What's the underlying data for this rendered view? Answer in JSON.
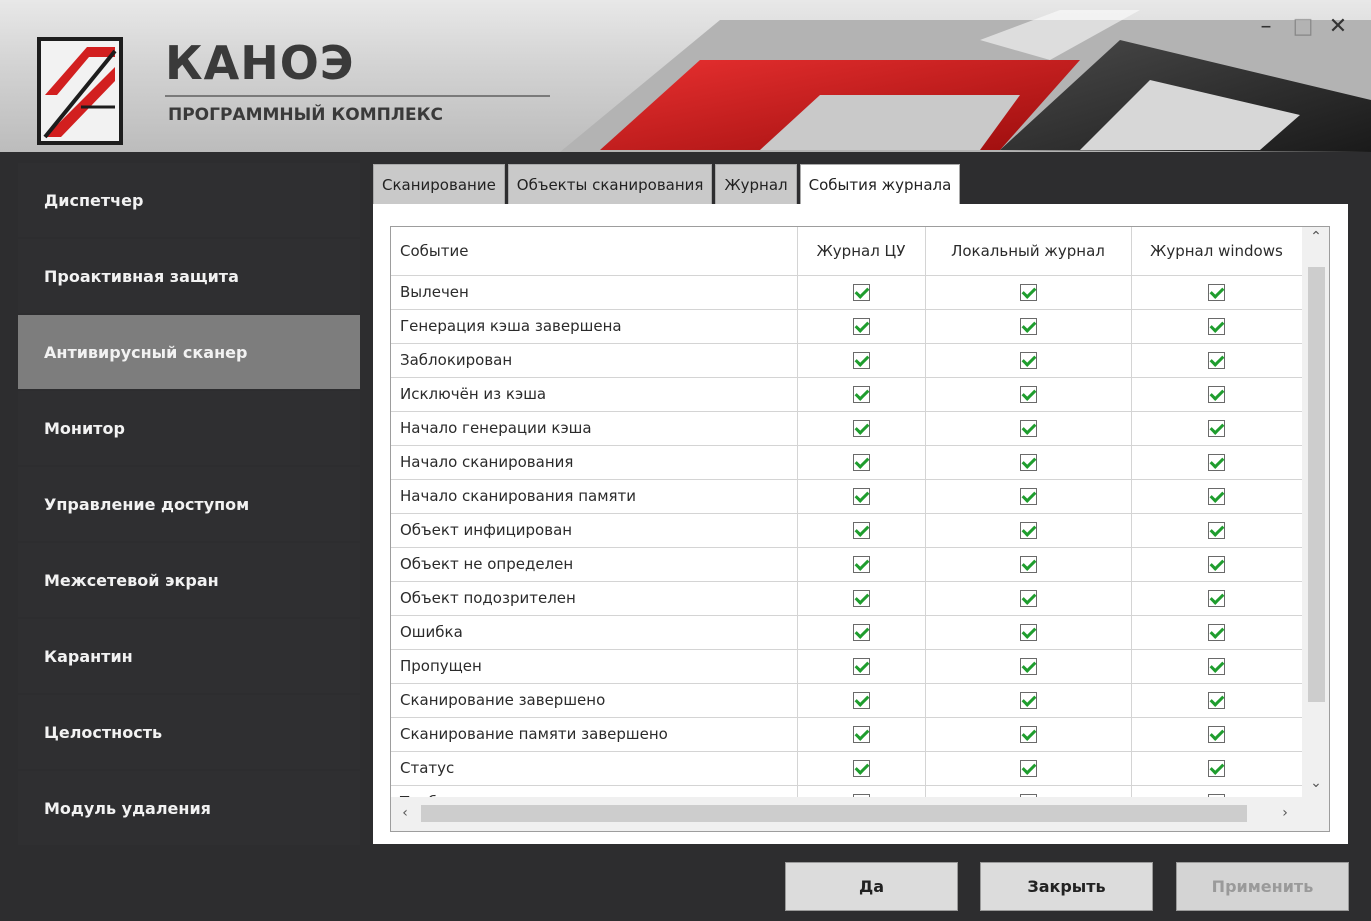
{
  "window": {
    "brand": "КАНОЭ",
    "subtitle": "ПРОГРАММНЫЙ КОМПЛЕКС",
    "minimize": "–",
    "maximize": "□",
    "close": "✕"
  },
  "sidebar": {
    "items": [
      {
        "label": "Диспетчер",
        "active": false
      },
      {
        "label": "Проактивная защита",
        "active": false
      },
      {
        "label": "Антивирусный сканер",
        "active": true
      },
      {
        "label": "Монитор",
        "active": false
      },
      {
        "label": "Управление доступом",
        "active": false
      },
      {
        "label": "Межсетевой экран",
        "active": false
      },
      {
        "label": "Карантин",
        "active": false
      },
      {
        "label": "Целостность",
        "active": false
      },
      {
        "label": "Модуль удаления",
        "active": false
      }
    ]
  },
  "tabs": [
    {
      "label": "Сканирование",
      "active": false
    },
    {
      "label": "Объекты сканирования",
      "active": false
    },
    {
      "label": "Журнал",
      "active": false
    },
    {
      "label": "События журнала",
      "active": true
    }
  ],
  "table": {
    "columns": [
      "Событие",
      "Журнал ЦУ",
      "Локальный журнал",
      "Журнал windows"
    ],
    "rows": [
      {
        "event": "Вылечен",
        "cu": true,
        "local": true,
        "windows": true
      },
      {
        "event": "Генерация кэша завершена",
        "cu": true,
        "local": true,
        "windows": true
      },
      {
        "event": "Заблокирован",
        "cu": true,
        "local": true,
        "windows": true
      },
      {
        "event": "Исключён из кэша",
        "cu": true,
        "local": true,
        "windows": true
      },
      {
        "event": "Начало генерации кэша",
        "cu": true,
        "local": true,
        "windows": true
      },
      {
        "event": "Начало сканирования",
        "cu": true,
        "local": true,
        "windows": true
      },
      {
        "event": "Начало сканирования памяти",
        "cu": true,
        "local": true,
        "windows": true
      },
      {
        "event": "Объект инфицирован",
        "cu": true,
        "local": true,
        "windows": true
      },
      {
        "event": "Объект не определен",
        "cu": true,
        "local": true,
        "windows": true
      },
      {
        "event": "Объект подозрителен",
        "cu": true,
        "local": true,
        "windows": true
      },
      {
        "event": "Ошибка",
        "cu": true,
        "local": true,
        "windows": true
      },
      {
        "event": "Пропущен",
        "cu": true,
        "local": true,
        "windows": true
      },
      {
        "event": "Сканирование завершено",
        "cu": true,
        "local": true,
        "windows": true
      },
      {
        "event": "Сканирование памяти завершено",
        "cu": true,
        "local": true,
        "windows": true
      },
      {
        "event": "Статус",
        "cu": true,
        "local": true,
        "windows": true
      },
      {
        "event": "Требуется перезагрузка",
        "cu": true,
        "local": true,
        "windows": true
      }
    ]
  },
  "buttons": {
    "ok": "Да",
    "close": "Закрыть",
    "apply": "Применить",
    "apply_disabled": true
  },
  "colors": {
    "accent_red": "#d21f1f",
    "active_nav": "#7d7d7d",
    "checkmark": "#1f9d2e"
  }
}
